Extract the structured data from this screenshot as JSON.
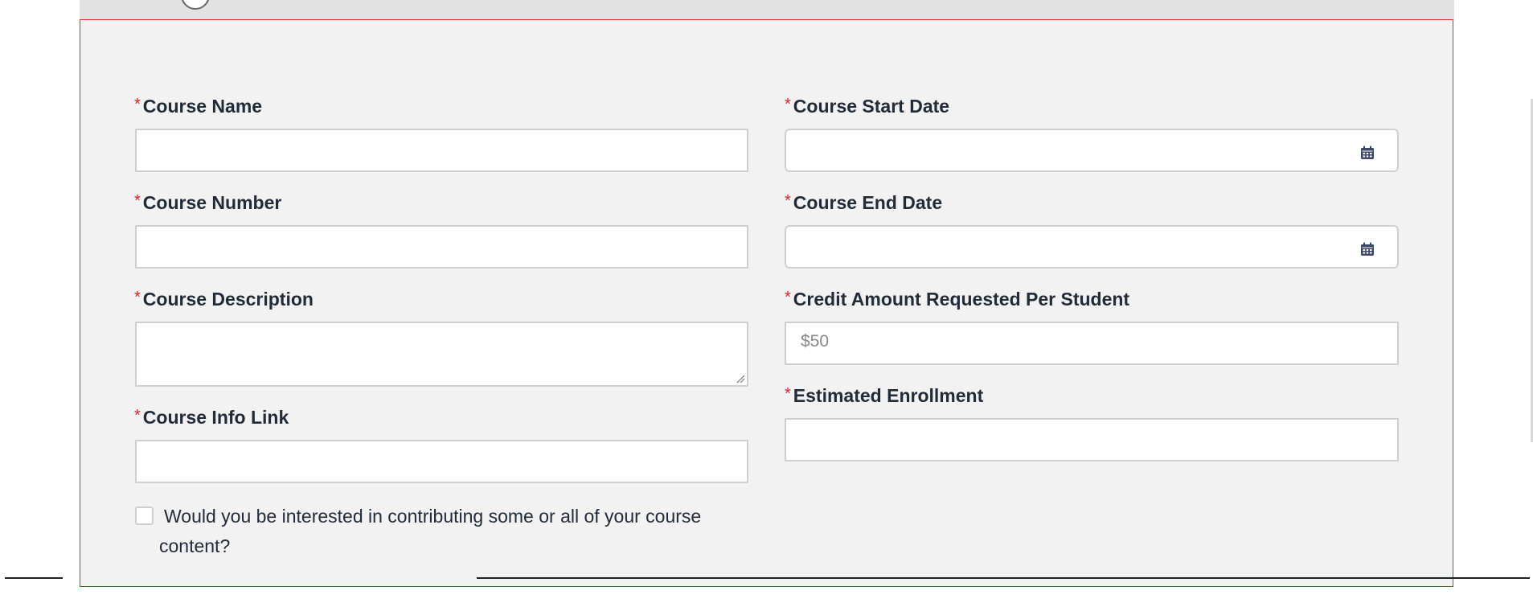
{
  "form": {
    "course_name": {
      "label": "Course Name",
      "value": "",
      "placeholder": ""
    },
    "course_number": {
      "label": "Course Number",
      "value": "",
      "placeholder": ""
    },
    "course_description": {
      "label": "Course Description",
      "value": "",
      "placeholder": ""
    },
    "course_info_link": {
      "label": "Course Info Link",
      "value": "",
      "placeholder": ""
    },
    "course_start_date": {
      "label": "Course Start Date",
      "value": "",
      "icon": "calendar-icon"
    },
    "course_end_date": {
      "label": "Course End Date",
      "value": "",
      "icon": "calendar-icon"
    },
    "credit_amount": {
      "label": "Credit Amount Requested Per Student",
      "value": "",
      "placeholder": "$50"
    },
    "estimated_enrollment": {
      "label": "Estimated Enrollment",
      "value": "",
      "placeholder": ""
    },
    "contribute_content": {
      "label": "Would you be interested in contributing some or all of your course content?",
      "checked": false
    },
    "required_marker": "*"
  },
  "colors": {
    "panel_background": "#f2f2f2",
    "panel_border": "#e0282d",
    "required_marker": "#d0262b",
    "label_text": "#222b38",
    "input_border": "#cfcfcf",
    "calendar_icon": "#3d4a66"
  }
}
